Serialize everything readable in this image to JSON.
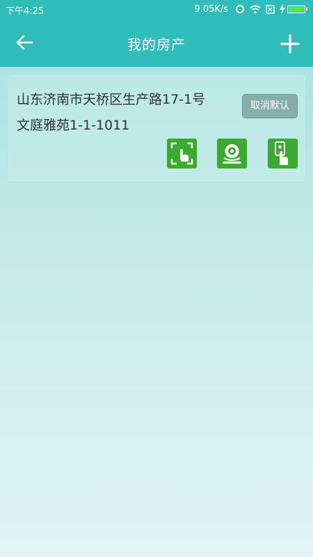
{
  "status_bar": {
    "time": "下午4:25",
    "net_speed": "9.05K/s",
    "icons": [
      "sync-icon",
      "wifi-icon",
      "no-sim-icon",
      "charging-icon",
      "battery-icon"
    ],
    "battery_level": 1.0
  },
  "app_bar": {
    "title": "我的房产",
    "back_icon": "arrow-left-icon",
    "add_icon": "plus-icon"
  },
  "property": {
    "address_line1": "山东济南市天桥区生产路17-1号",
    "address_line2": "文庭雅苑1-1-1011",
    "cancel_default_label": "取消默认",
    "actions": [
      {
        "icon": "scan-unlock-icon"
      },
      {
        "icon": "camera-icon"
      },
      {
        "icon": "touch-key-icon"
      }
    ]
  },
  "colors": {
    "primary": "#30bdb9",
    "action_green": "#3aab2f",
    "button_gray": "#89adab",
    "text_dark": "#2f3335"
  }
}
